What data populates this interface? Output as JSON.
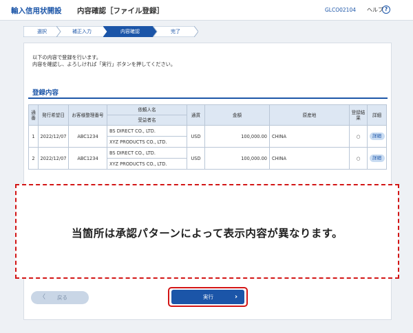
{
  "header": {
    "app_title": "輸入信用状開設",
    "page_title": "内容確認［ファイル登録］",
    "screen_id": "GLCO02104",
    "help_label": "ヘルプ",
    "help_icon_glyph": "?"
  },
  "steps": [
    {
      "label": "選択",
      "state": "done"
    },
    {
      "label": "補正入力",
      "state": "done"
    },
    {
      "label": "内容確認",
      "state": "current"
    },
    {
      "label": "完了",
      "state": "todo"
    }
  ],
  "message": {
    "line1": "以下の内容で登録を行います。",
    "line2": "内容を確認し、よろしければ「実行」ボタンを押してください。"
  },
  "section_title": "登録内容",
  "table": {
    "headers": {
      "no": "通番",
      "date": "発行希望日",
      "ref": "お客様整理番号",
      "applicant": "依頼人名",
      "beneficiary": "受益者名",
      "currency": "通貨",
      "amount": "金額",
      "origin": "原産地",
      "registered": "登録結果",
      "detail": "詳細"
    },
    "rows": [
      {
        "no": "1",
        "date": "2022/12/07",
        "ref": "ABC1234",
        "applicant": "BS DIRECT CO., LTD.",
        "beneficiary": "XYZ PRODUCTS CO., LTD.",
        "currency": "USD",
        "amount": "100,000.00",
        "origin": "CHINA",
        "registered": "○",
        "detail": "詳細"
      },
      {
        "no": "2",
        "date": "2022/12/07",
        "ref": "ABC1234",
        "applicant": "BS DIRECT CO., LTD.",
        "beneficiary": "XYZ PRODUCTS CO., LTD.",
        "currency": "USD",
        "amount": "100,000.00",
        "origin": "CHINA",
        "registered": "○",
        "detail": "詳細"
      }
    ]
  },
  "notice": "当箇所は承認パターンによって表示内容が異なります。",
  "buttons": {
    "back": "戻る",
    "back_icon": "chevron-left-icon",
    "execute": "実行",
    "execute_icon": "chevron-right-icon"
  },
  "colors": {
    "brand": "#1b55a8",
    "highlight": "#d21414",
    "header_cell": "#dde7f3"
  }
}
